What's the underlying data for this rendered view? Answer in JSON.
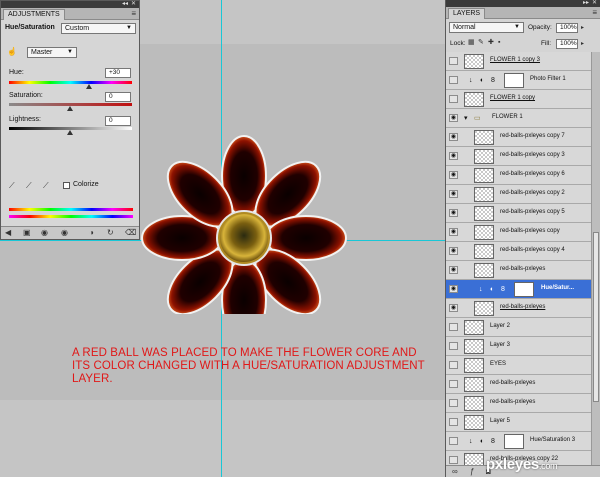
{
  "canvas": {
    "caption_lines": [
      "A RED BALL WAS PLACED TO MAKE THE FLOWER CORE AND",
      "ITS COLOR CHANGED WITH A HUE/SATURATION ADJUSTMENT",
      "LAYER."
    ],
    "guide_color": "#19c7d6",
    "caption_color": "#e01818"
  },
  "adjustments": {
    "title": "ADJUSTMENTS",
    "adjustment_name": "Hue/Saturation",
    "preset": "Custom",
    "range": "Master",
    "hue_label": "Hue:",
    "hue_value": "+30",
    "saturation_label": "Saturation:",
    "saturation_value": "0",
    "lightness_label": "Lightness:",
    "lightness_value": "0",
    "colorize_label": "Colorize"
  },
  "layers": {
    "title": "LAYERS",
    "blend_mode": "Normal",
    "opacity_label": "Opacity:",
    "opacity_value": "100%",
    "lock_label": "Lock:",
    "fill_label": "Fill:",
    "fill_value": "100%",
    "items": [
      {
        "name": "FLOWER 1 copy 3",
        "type": "smart",
        "visible": false,
        "underline": true
      },
      {
        "name": "Photo Filter 1",
        "type": "adjustment",
        "visible": false
      },
      {
        "name": "FLOWER 1 copy",
        "type": "smart",
        "visible": false,
        "underline": true
      },
      {
        "name": "FLOWER 1",
        "type": "group",
        "visible": true
      },
      {
        "name": "red-balls-pxleyes copy 7",
        "type": "pixel",
        "visible": true
      },
      {
        "name": "red-balls-pxleyes copy 3",
        "type": "pixel",
        "visible": true
      },
      {
        "name": "red-balls-pxleyes copy 6",
        "type": "pixel",
        "visible": true
      },
      {
        "name": "red-balls-pxleyes copy 2",
        "type": "pixel",
        "visible": true
      },
      {
        "name": "red-balls-pxleyes copy 5",
        "type": "pixel",
        "visible": true
      },
      {
        "name": "red-balls-pxleyes copy",
        "type": "pixel",
        "visible": true
      },
      {
        "name": "red-balls-pxleyes copy 4",
        "type": "pixel",
        "visible": true
      },
      {
        "name": "red-balls-pxleyes",
        "type": "pixel",
        "visible": true
      },
      {
        "name": "Hue/Satur...",
        "type": "adjustment",
        "visible": true,
        "selected": true
      },
      {
        "name": "red-balls-pxleyes",
        "type": "pixel",
        "visible": true,
        "underline": true
      },
      {
        "name": "Layer 2",
        "type": "pixel",
        "visible": false
      },
      {
        "name": "Layer 3",
        "type": "pixel",
        "visible": false
      },
      {
        "name": "EYES",
        "type": "pixel",
        "visible": false
      },
      {
        "name": "red-balls-pxleyes",
        "type": "pixel",
        "visible": false
      },
      {
        "name": "red-balls-pxleyes",
        "type": "pixel",
        "visible": false
      },
      {
        "name": "Layer 5",
        "type": "pixel",
        "visible": false
      },
      {
        "name": "Hue/Saturation 3",
        "type": "adjustment",
        "visible": false
      },
      {
        "name": "red-balls-pxleyes copy 22",
        "type": "pixel",
        "visible": false
      }
    ]
  },
  "watermark": {
    "brand": "pxleyes",
    "tld": ".com"
  }
}
